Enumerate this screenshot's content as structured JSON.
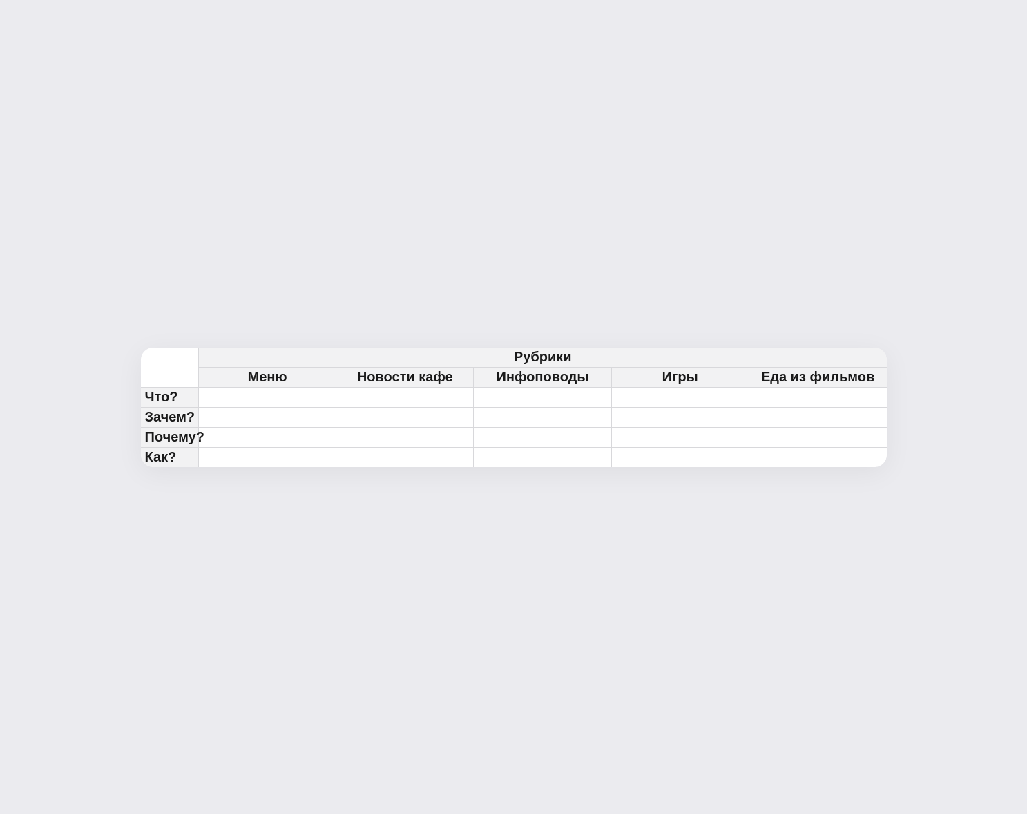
{
  "table": {
    "super_header": "Рубрики",
    "columns": [
      "Меню",
      "Новости кафе",
      "Инфоповоды",
      "Игры",
      "Еда из фильмов"
    ],
    "rows": [
      {
        "label": "Что?",
        "cells": [
          "",
          "",
          "",
          "",
          ""
        ]
      },
      {
        "label": "Зачем?",
        "cells": [
          "",
          "",
          "",
          "",
          ""
        ]
      },
      {
        "label": "Почему?",
        "cells": [
          "",
          "",
          "",
          "",
          ""
        ]
      },
      {
        "label": "Как?",
        "cells": [
          "",
          "",
          "",
          "",
          ""
        ]
      }
    ]
  }
}
